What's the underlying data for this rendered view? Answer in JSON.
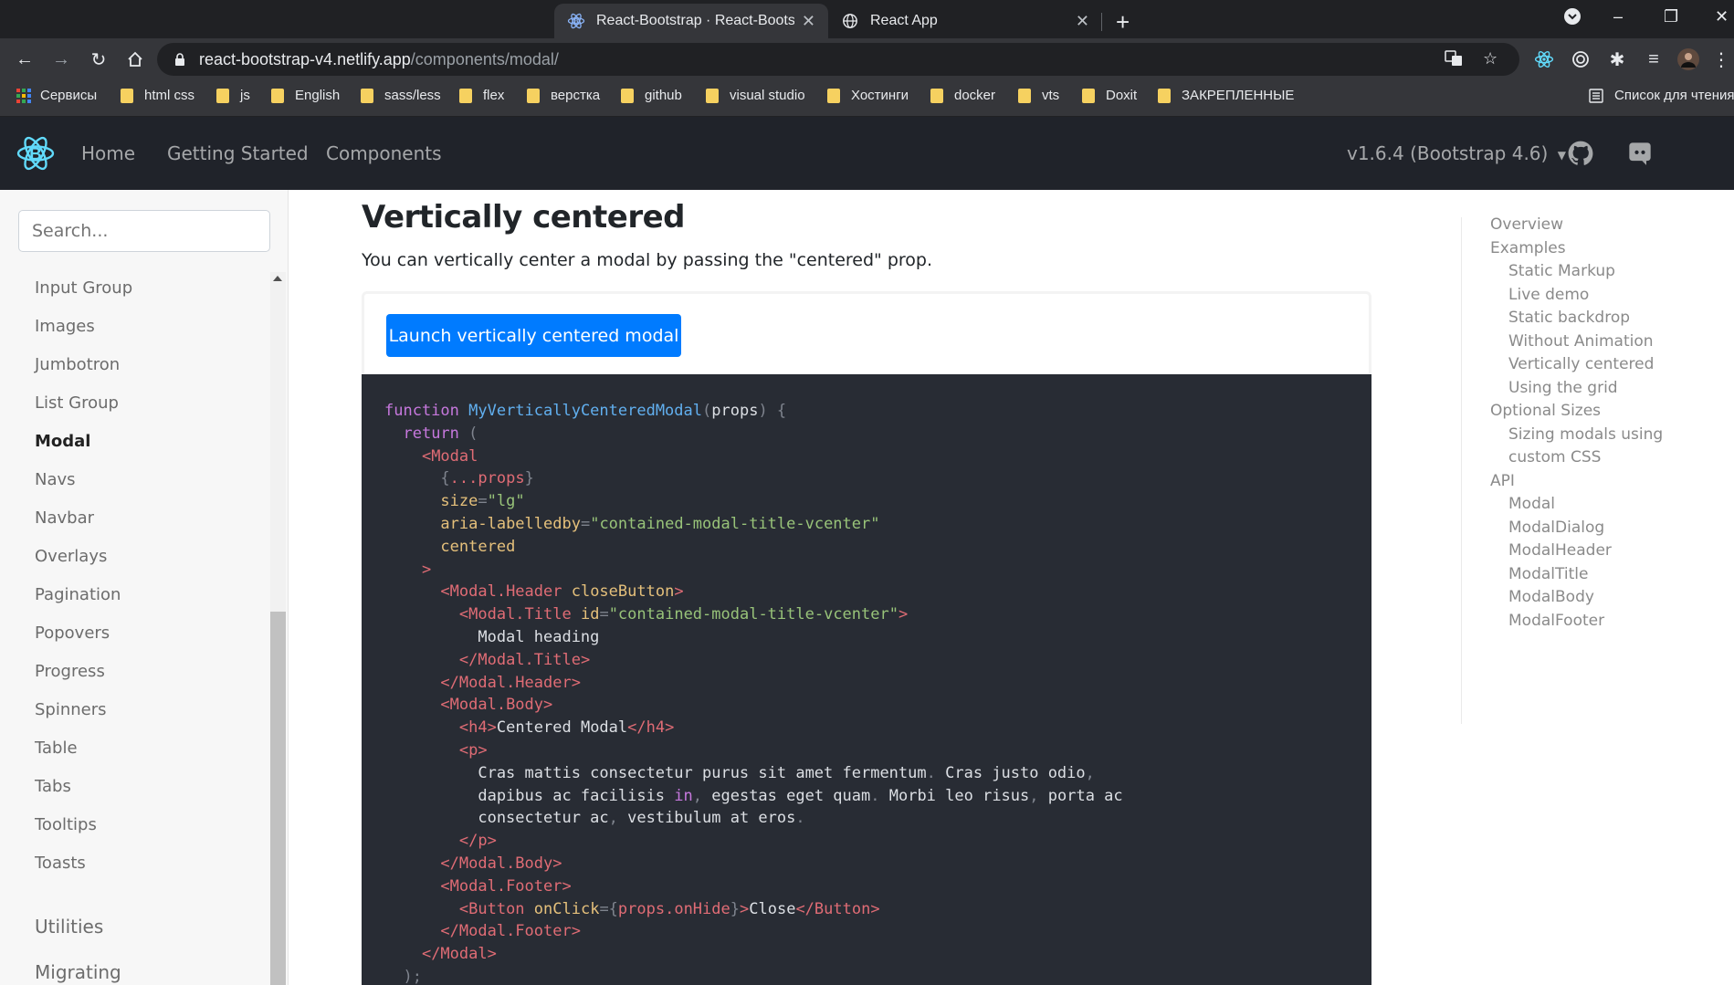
{
  "browser": {
    "tabs": [
      {
        "title": "React-Bootstrap · React-Bootstrap",
        "active": true
      },
      {
        "title": "React App",
        "active": false
      }
    ],
    "url_host": "react-bootstrap-v4.netlify.app",
    "url_path": "/components/modal/",
    "bookmarks": [
      "Сервисы",
      "html css",
      "js",
      "English",
      "sass/less",
      "flex",
      "верстка",
      "github",
      "visual studio",
      "Хостинги",
      "docker",
      "vts",
      "Doxit",
      "ЗАКРЕПЛЕННЫЕ"
    ],
    "reading_list": "Список для чтения"
  },
  "navbar": {
    "links": [
      "Home",
      "Getting Started",
      "Components"
    ],
    "version": "v1.6.4 (Bootstrap 4.6)"
  },
  "sidebar": {
    "search_placeholder": "Search...",
    "items": [
      "Input Group",
      "Images",
      "Jumbotron",
      "List Group",
      "Modal",
      "Navs",
      "Navbar",
      "Overlays",
      "Pagination",
      "Popovers",
      "Progress",
      "Spinners",
      "Table",
      "Tabs",
      "Tooltips",
      "Toasts"
    ],
    "active_item": "Modal",
    "sections": [
      "Utilities",
      "Migrating"
    ]
  },
  "main": {
    "heading": "Vertically centered",
    "description": "You can vertically center a modal by passing the \"centered\" prop.",
    "launch_button": "Launch vertically centered modal"
  },
  "code": [
    [
      [
        "kw",
        "function "
      ],
      [
        "fn",
        "MyVerticallyCenteredModal"
      ],
      [
        "punc",
        "("
      ],
      [
        "plain",
        "props"
      ],
      [
        "punc",
        ") {"
      ]
    ],
    [
      [
        "plain",
        "  "
      ],
      [
        "kw",
        "return "
      ],
      [
        "punc",
        "("
      ]
    ],
    [
      [
        "plain",
        "    "
      ],
      [
        "tag",
        "<Modal"
      ]
    ],
    [
      [
        "plain",
        "      "
      ],
      [
        "punc",
        "{"
      ],
      [
        "tag",
        "...props"
      ],
      [
        "punc",
        "}"
      ]
    ],
    [
      [
        "plain",
        "      "
      ],
      [
        "attr",
        "size"
      ],
      [
        "punc",
        "="
      ],
      [
        "str",
        "\"lg\""
      ]
    ],
    [
      [
        "plain",
        "      "
      ],
      [
        "attr",
        "aria-labelledby"
      ],
      [
        "punc",
        "="
      ],
      [
        "str",
        "\"contained-modal-title-vcenter\""
      ]
    ],
    [
      [
        "plain",
        "      "
      ],
      [
        "attr",
        "centered"
      ]
    ],
    [
      [
        "plain",
        "    "
      ],
      [
        "tag",
        ">"
      ]
    ],
    [
      [
        "plain",
        "      "
      ],
      [
        "tag",
        "<Modal.Header "
      ],
      [
        "attr",
        "closeButton"
      ],
      [
        "tag",
        ">"
      ]
    ],
    [
      [
        "plain",
        "        "
      ],
      [
        "tag",
        "<Modal.Title "
      ],
      [
        "attr",
        "id"
      ],
      [
        "punc",
        "="
      ],
      [
        "str",
        "\"contained-modal-title-vcenter\""
      ],
      [
        "tag",
        ">"
      ]
    ],
    [
      [
        "plain",
        "          Modal heading"
      ]
    ],
    [
      [
        "plain",
        "        "
      ],
      [
        "tag",
        "</Modal.Title>"
      ]
    ],
    [
      [
        "plain",
        "      "
      ],
      [
        "tag",
        "</Modal.Header>"
      ]
    ],
    [
      [
        "plain",
        "      "
      ],
      [
        "tag",
        "<Modal.Body>"
      ]
    ],
    [
      [
        "plain",
        "        "
      ],
      [
        "tag",
        "<h4>"
      ],
      [
        "plain",
        "Centered Modal"
      ],
      [
        "tag",
        "</h4>"
      ]
    ],
    [
      [
        "plain",
        "        "
      ],
      [
        "tag",
        "<p>"
      ]
    ],
    [
      [
        "plain",
        "          Cras mattis consectetur purus sit amet fermentum"
      ],
      [
        "punc",
        "."
      ],
      [
        "plain",
        " Cras justo odio"
      ],
      [
        "punc",
        ","
      ]
    ],
    [
      [
        "plain",
        "          dapibus ac facilisis "
      ],
      [
        "kw",
        "in"
      ],
      [
        "punc",
        ","
      ],
      [
        "plain",
        " egestas eget quam"
      ],
      [
        "punc",
        "."
      ],
      [
        "plain",
        " Morbi leo risus"
      ],
      [
        "punc",
        ","
      ],
      [
        "plain",
        " porta ac"
      ]
    ],
    [
      [
        "plain",
        "          consectetur ac"
      ],
      [
        "punc",
        ","
      ],
      [
        "plain",
        " vestibulum at eros"
      ],
      [
        "punc",
        "."
      ]
    ],
    [
      [
        "plain",
        "        "
      ],
      [
        "tag",
        "</p>"
      ]
    ],
    [
      [
        "plain",
        "      "
      ],
      [
        "tag",
        "</Modal.Body>"
      ]
    ],
    [
      [
        "plain",
        "      "
      ],
      [
        "tag",
        "<Modal.Footer>"
      ]
    ],
    [
      [
        "plain",
        "        "
      ],
      [
        "tag",
        "<Button "
      ],
      [
        "attr",
        "onClick"
      ],
      [
        "punc",
        "={"
      ],
      [
        "tag",
        "props.onHide"
      ],
      [
        "punc",
        "}"
      ],
      [
        "tag",
        ">"
      ],
      [
        "plain",
        "Close"
      ],
      [
        "tag",
        "</Button>"
      ]
    ],
    [
      [
        "plain",
        "      "
      ],
      [
        "tag",
        "</Modal.Footer>"
      ]
    ],
    [
      [
        "plain",
        "    "
      ],
      [
        "tag",
        "</Modal>"
      ]
    ],
    [
      [
        "plain",
        "  "
      ],
      [
        "punc",
        ");"
      ]
    ]
  ],
  "toc": [
    {
      "label": "Overview",
      "level": 1
    },
    {
      "label": "Examples",
      "level": 1
    },
    {
      "label": "Static Markup",
      "level": 2
    },
    {
      "label": "Live demo",
      "level": 2
    },
    {
      "label": "Static backdrop",
      "level": 2
    },
    {
      "label": "Without Animation",
      "level": 2
    },
    {
      "label": "Vertically centered",
      "level": 2
    },
    {
      "label": "Using the grid",
      "level": 2
    },
    {
      "label": "Optional Sizes",
      "level": 1
    },
    {
      "label": "Sizing modals using",
      "level": 2
    },
    {
      "label": "custom CSS",
      "level": 2
    },
    {
      "label": "API",
      "level": 1
    },
    {
      "label": "Modal",
      "level": 2
    },
    {
      "label": "ModalDialog",
      "level": 2
    },
    {
      "label": "ModalHeader",
      "level": 2
    },
    {
      "label": "ModalTitle",
      "level": 2
    },
    {
      "label": "ModalBody",
      "level": 2
    },
    {
      "label": "ModalFooter",
      "level": 2
    }
  ],
  "colors": {
    "navbar_bg": "#20232a",
    "primary_button": "#007bff",
    "code_bg": "#282c34",
    "react_blue": "#61dafb"
  }
}
